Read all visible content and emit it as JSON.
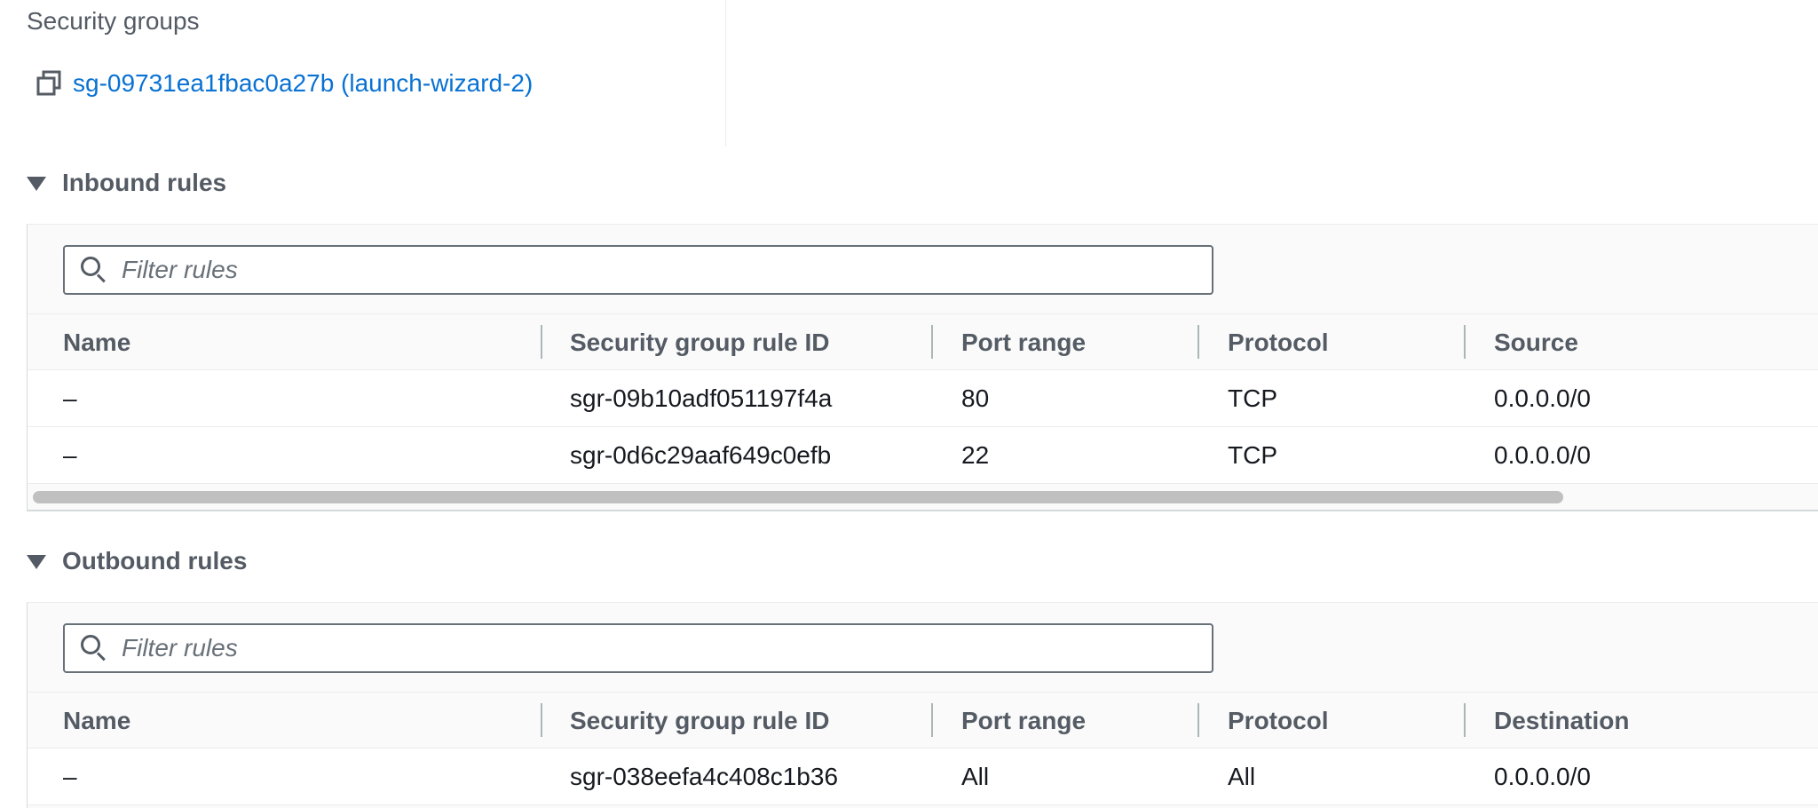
{
  "security_groups": {
    "label": "Security groups",
    "link_text": "sg-09731ea1fbac0a27b (launch-wizard-2)"
  },
  "inbound": {
    "title": "Inbound rules",
    "filter_placeholder": "Filter rules",
    "columns": [
      "Name",
      "Security group rule ID",
      "Port range",
      "Protocol",
      "Source"
    ],
    "rows": [
      [
        "–",
        "sgr-09b10adf051197f4a",
        "80",
        "TCP",
        "0.0.0.0/0"
      ],
      [
        "–",
        "sgr-0d6c29aaf649c0efb",
        "22",
        "TCP",
        "0.0.0.0/0"
      ]
    ]
  },
  "outbound": {
    "title": "Outbound rules",
    "filter_placeholder": "Filter rules",
    "columns": [
      "Name",
      "Security group rule ID",
      "Port range",
      "Protocol",
      "Destination"
    ],
    "rows": [
      [
        "–",
        "sgr-038eefa4c408c1b36",
        "All",
        "All",
        "0.0.0.0/0"
      ]
    ]
  },
  "icons": {
    "copy": "copy-icon",
    "search": "search-icon",
    "expand": "caret-down-icon"
  },
  "colors": {
    "link": "#0972d3",
    "muted_text": "#545b64",
    "text": "#16191f"
  }
}
